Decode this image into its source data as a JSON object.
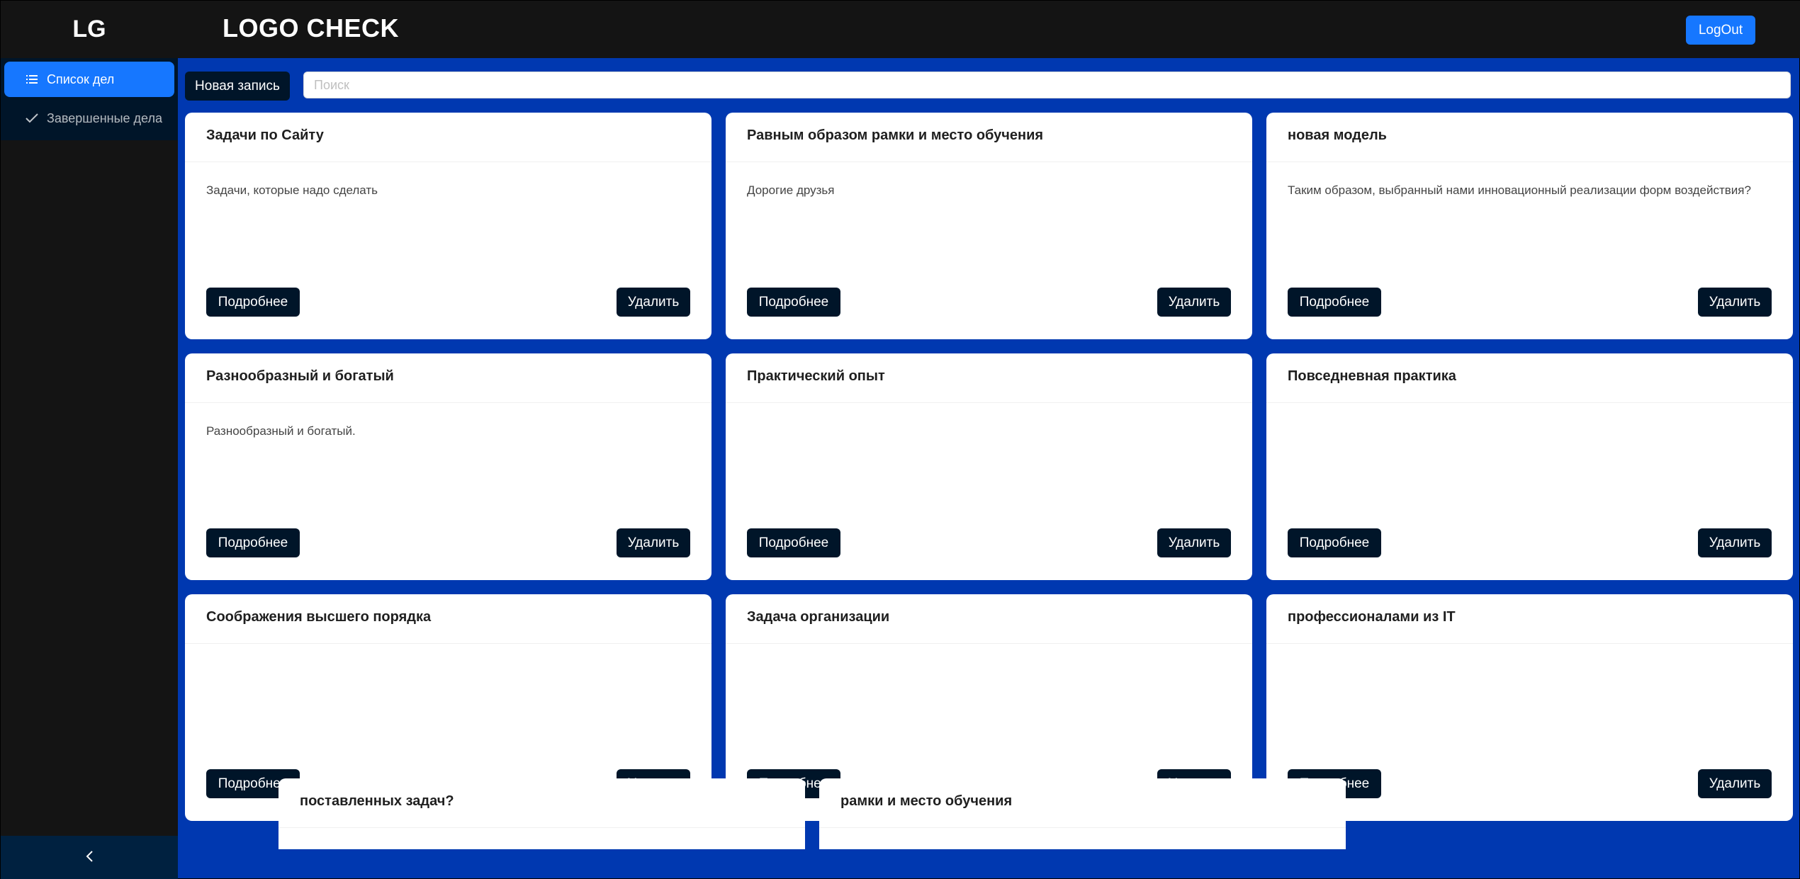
{
  "header": {
    "logo": "LG",
    "title": "LOGO CHECK",
    "logout_label": "LogOut"
  },
  "sidebar": {
    "items": [
      {
        "label": "Список дел",
        "icon": "list-icon",
        "active": true
      },
      {
        "label": "Завершенные дела",
        "icon": "check-icon",
        "active": false
      }
    ],
    "collapse_icon": "chevron-left-icon"
  },
  "toolbar": {
    "new_label": "Новая запись",
    "search_placeholder": "Поиск"
  },
  "cards": [
    {
      "title": "Задачи по Сайту",
      "body": "Задачи, которые надо сделать",
      "more_label": "Подробнее",
      "delete_label": "Удалить"
    },
    {
      "title": "Равным образом рамки и место обучения",
      "body": "Дорогие друзья",
      "more_label": "Подробнее",
      "delete_label": "Удалить"
    },
    {
      "title": "новая модель",
      "body": "Таким образом, выбранный нами инновационный реализации форм воздействия?",
      "more_label": "Подробнее",
      "delete_label": "Удалить"
    },
    {
      "title": "Разнообразный и богатый",
      "body": "Разнообразный и богатый.",
      "more_label": "Подробнее",
      "delete_label": "Удалить"
    },
    {
      "title": "Практический опыт",
      "body": "",
      "more_label": "Подробнее",
      "delete_label": "Удалить"
    },
    {
      "title": "Повседневная практика",
      "body": "",
      "more_label": "Подробнее",
      "delete_label": "Удалить"
    },
    {
      "title": "Соображения высшего порядка",
      "body": "",
      "more_label": "Подробнее",
      "delete_label": "Удалить"
    },
    {
      "title": "Задача организации",
      "body": "",
      "more_label": "Подробнее",
      "delete_label": "Удалить"
    },
    {
      "title": "профессионалами из IT",
      "body": "",
      "more_label": "Подробнее",
      "delete_label": "Удалить"
    }
  ],
  "partial_cards": [
    {
      "title": "поставленных задач?"
    },
    {
      "title": "рамки и место обучения"
    }
  ],
  "colors": {
    "header_bg": "#141414",
    "content_bg": "#0038b0",
    "accent": "#1677ff",
    "dark_button": "#001529"
  }
}
